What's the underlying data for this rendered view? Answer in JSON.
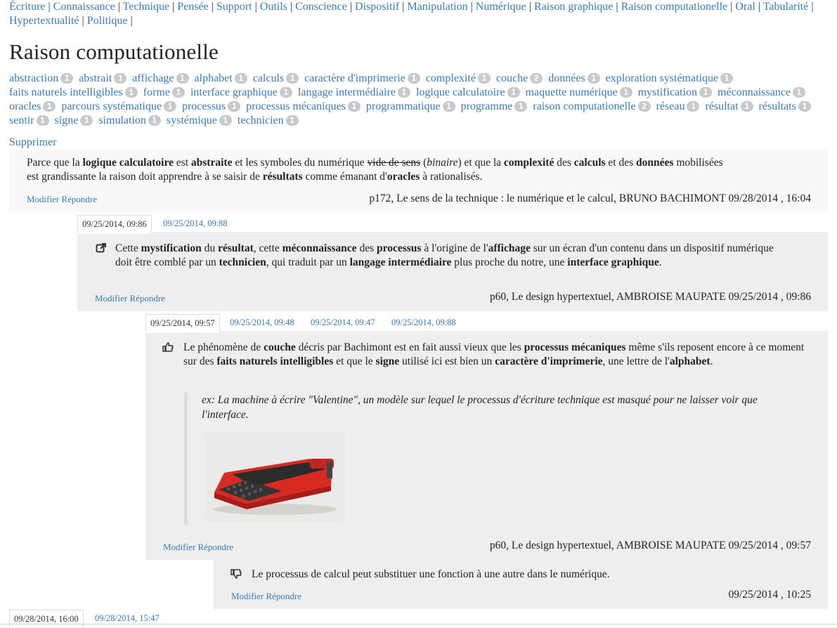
{
  "nav": {
    "items": [
      "Écriture",
      "Connaissance",
      "Technique",
      "Pensée",
      "Support",
      "Outils",
      "Conscience",
      "Dispositif",
      "Manipulation",
      "Numérique",
      "Raison graphique",
      "Raison computationelle",
      "Oral",
      "Tabularité",
      "Hypertextualité",
      "Politique"
    ],
    "separator": "|"
  },
  "page_title": "Raison computationelle",
  "tags": [
    {
      "label": "abstraction",
      "count": "1"
    },
    {
      "label": "abstrait",
      "count": "1"
    },
    {
      "label": "affichage",
      "count": "1"
    },
    {
      "label": "alphabet",
      "count": "1"
    },
    {
      "label": "calculs",
      "count": "1"
    },
    {
      "label": "caractère d'imprimerie",
      "count": "1"
    },
    {
      "label": "complexité",
      "count": "1"
    },
    {
      "label": "couche",
      "count": "2"
    },
    {
      "label": "données",
      "count": "1"
    },
    {
      "label": "exploration systématique",
      "count": "1"
    },
    {
      "label": "faits naturels intelligibles",
      "count": "1"
    },
    {
      "label": "forme",
      "count": "1"
    },
    {
      "label": "interface graphique",
      "count": "1"
    },
    {
      "label": "langage intermédiaire",
      "count": "1"
    },
    {
      "label": "logique calculatoire",
      "count": "1"
    },
    {
      "label": "maquette numérique",
      "count": "1"
    },
    {
      "label": "mystification",
      "count": "1"
    },
    {
      "label": "méconnaissance",
      "count": "1"
    },
    {
      "label": "oracles",
      "count": "1"
    },
    {
      "label": "parcours systématique",
      "count": "1"
    },
    {
      "label": "processus",
      "count": "1"
    },
    {
      "label": "processus mécaniques",
      "count": "1"
    },
    {
      "label": "programmatique",
      "count": "1"
    },
    {
      "label": "programme",
      "count": "1"
    },
    {
      "label": "raison computationelle",
      "count": "2"
    },
    {
      "label": "réseau",
      "count": "1"
    },
    {
      "label": "résultat",
      "count": "1"
    },
    {
      "label": "résultats",
      "count": "1"
    },
    {
      "label": "sentir",
      "count": "1"
    },
    {
      "label": "signe",
      "count": "1"
    },
    {
      "label": "simulation",
      "count": "1"
    },
    {
      "label": "systémique",
      "count": "1"
    },
    {
      "label": "technicien",
      "count": "1"
    }
  ],
  "supprimer_label": "Supprimer",
  "actions": {
    "modifier": "Modifier",
    "repondre": "Répondre"
  },
  "comment1": {
    "t1": "Parce que la ",
    "b1": "logique calculatoire",
    "t2": " est ",
    "b2": "abstraite",
    "t3": " et les symboles du numérique ",
    "strike": "vide de sens",
    "t4": " (",
    "italic": "binaire",
    "t5": ") et que la ",
    "b3": "complexité",
    "t6": " des ",
    "b4": "calculs",
    "t7": " et des ",
    "b5": "données",
    "t8": " mobilisées est grandissante la raison doit apprendre à se saisir de ",
    "b6": "résultats",
    "t9": " comme émanant d'",
    "b7": "oracles",
    "t10": " à rationalisés.",
    "cite": "p172, Le sens de la technique : le numérique et le calcul, BRUNO BACHIMONT 09/28/2014 , 16:04"
  },
  "tabs2": [
    "09/25/2014, 09:86",
    "09/25/2014, 09:88"
  ],
  "comment2": {
    "icon": "external-link-icon",
    "t1": "Cette ",
    "b1": "mystification",
    "t2": " du ",
    "b2": "résultat",
    "t3": ", cette ",
    "b3": "méconnaissance",
    "t4": " des ",
    "b4": "processus",
    "t5": " à l'origine de l'",
    "b5": "affichage",
    "t6": " sur un écran d'un contenu dans un dispositif numérique doit être comblé par un ",
    "b6": "technicien",
    "t7": ", qui traduit par un ",
    "b7": "langage intermédiaire",
    "t8": " plus proche du notre, une ",
    "b8": "interface graphique",
    "t9": ".",
    "cite": "p60, Le design hypertextuel, AMBROISE MAUPATE 09/25/2014 , 09:86"
  },
  "tabs3": [
    "09/25/2014, 09:57",
    "09/25/2014, 09:48",
    "09/25/2014, 09:47",
    "09/25/2014, 09:88"
  ],
  "comment3": {
    "icon": "thumbs-up-icon",
    "t1": "Le phénomène de ",
    "b1": "couche",
    "t2": " décris par Bachimont est en fait aussi vieux que les ",
    "b2": "processus mécaniques",
    "t3": " même s'ils reposent encore à ce moment sur des ",
    "b3": "faits naturels intelligibles",
    "t4": " et que le ",
    "b4": "signe",
    "t5": " utilisé ici est bien un ",
    "b5": "caractère d'imprimerie",
    "t6": ", une lettre de l'",
    "b6": "alphabet",
    "t7": ".",
    "quote": "ex: La machine à écrire \"Valentine\", un modèle sur lequel le processus d'écriture technique est masqué pour ne laisser voir que l'interface.",
    "cite": "p60, Le design hypertextuel, AMBROISE MAUPATE 09/25/2014 , 09:57"
  },
  "comment4": {
    "icon": "thumbs-down-icon",
    "text": "Le processus de calcul peut substituer une fonction à une autre dans le numérique.",
    "cite": "09/25/2014 , 10:25"
  },
  "tabs5": [
    "09/28/2014, 16:00",
    "09/28/2014, 15:47"
  ],
  "colors": {
    "link": "#3d78b0",
    "badge": "#c9c9c9",
    "panel": "#eeeeee",
    "panel_light": "#f8f8f8",
    "typewriter": "#d62a22"
  }
}
